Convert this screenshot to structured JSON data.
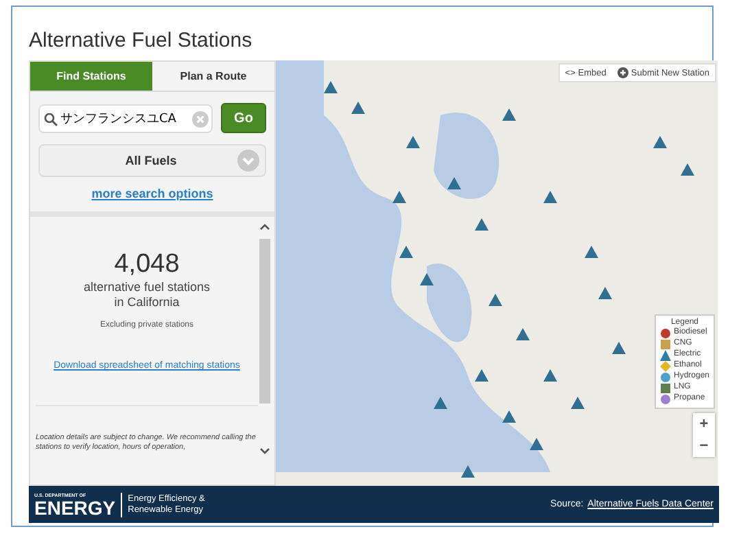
{
  "title": "Alternative Fuel Stations",
  "tabs": [
    {
      "label": "Find Stations",
      "selected": true
    },
    {
      "label": "Plan a Route",
      "selected": false
    }
  ],
  "search": {
    "value": "サンフランシスユCA",
    "button": "Go"
  },
  "fuel_dropdown": {
    "value": "All Fuels"
  },
  "more_link": "more search options",
  "results": {
    "count": "4,048",
    "line_1": "alternative fuel stations",
    "line_2": "in California",
    "note": "Excluding private stations",
    "download_link": "Download spreadsheet of matching stations",
    "disclaimer": "Location details are subject to change. We recommend calling the stations to verify location, hours of operation,"
  },
  "map": {
    "embed": "Embed",
    "embed_icon": "<>",
    "submit": "Submit New Station",
    "zoom_in": "+",
    "zoom_out": "−",
    "legend": {
      "title": "Legend",
      "items": [
        {
          "label": "Biodiesel",
          "kind": "circle",
          "color": "#c0392b"
        },
        {
          "label": "CNG",
          "kind": "square",
          "color": "#c8a24a"
        },
        {
          "label": "Electric",
          "kind": "triangle",
          "color": "#2f7fa5"
        },
        {
          "label": "Ethanol",
          "kind": "diamond",
          "color": "#e3b81e"
        },
        {
          "label": "Hydrogen",
          "kind": "circle",
          "color": "#4aa3c8"
        },
        {
          "label": "LNG",
          "kind": "square",
          "color": "#5f7f4f"
        },
        {
          "label": "Propane",
          "kind": "circle",
          "color": "#9b7fd0"
        }
      ]
    }
  },
  "footer": {
    "logo_top": "U.S. DEPARTMENT OF",
    "logo_main": "ENERGY",
    "office_1": "Energy Efficiency &",
    "office_2": "Renewable Energy",
    "source_label": "Source:",
    "source_link": "Alternative Fuels Data Center"
  }
}
